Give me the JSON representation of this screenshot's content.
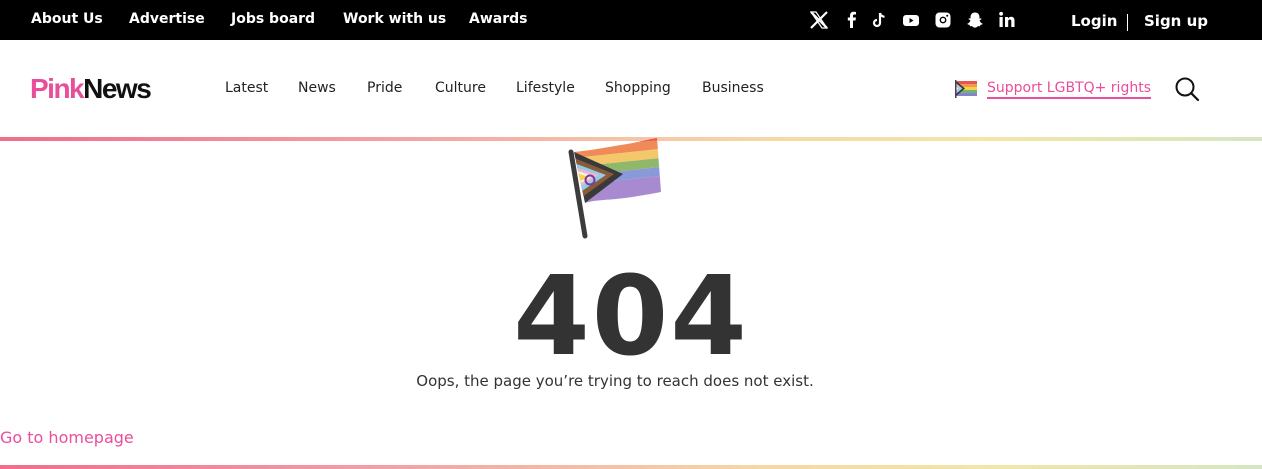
{
  "topbar": {
    "links": [
      "About Us",
      "Advertise",
      "Jobs board",
      "Work with us",
      "Awards"
    ],
    "social_icons": [
      "x-icon",
      "facebook-icon",
      "tiktok-icon",
      "youtube-icon",
      "instagram-icon",
      "snapchat-icon",
      "linkedin-icon"
    ],
    "login_label": "Login",
    "signup_label": "Sign up"
  },
  "header": {
    "logo_part1": "Pink",
    "logo_part2": "News",
    "nav": [
      "Latest",
      "News",
      "Pride",
      "Culture",
      "Lifestyle",
      "Shopping",
      "Business"
    ],
    "support_label": "Support LGBTQ+ rights",
    "search_icon": "search-icon"
  },
  "error": {
    "code": "404",
    "message": "Oops, the page you’re trying to reach does not exist.",
    "home_link": "Go to homepage"
  },
  "colors": {
    "brand_pink": "#e94e9b",
    "topbar_bg": "#000000",
    "text_dark": "#333333"
  }
}
